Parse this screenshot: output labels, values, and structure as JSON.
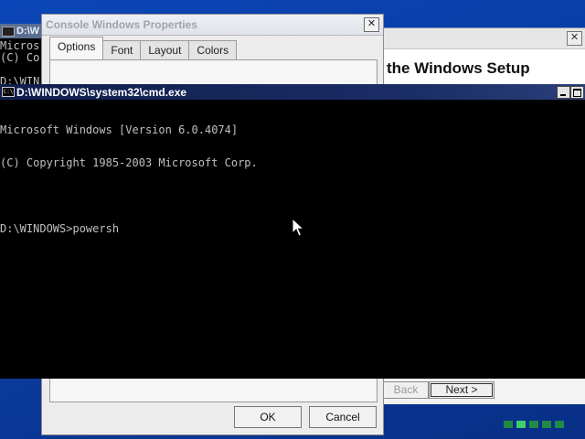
{
  "background_cmd": {
    "title": "D:\\W",
    "lines": [
      "Micros",
      "(C) Co",
      "",
      "D:\\WIN"
    ]
  },
  "setup": {
    "heading": "the Windows Setup",
    "back_label": "Back",
    "next_label": "Next >",
    "close_label": "✕"
  },
  "properties": {
    "title": "Console Windows Properties",
    "close_label": "✕",
    "tabs": [
      {
        "label": "Options",
        "active": true
      },
      {
        "label": "Font",
        "active": false
      },
      {
        "label": "Layout",
        "active": false
      },
      {
        "label": "Colors",
        "active": false
      }
    ],
    "ok_label": "OK",
    "cancel_label": "Cancel"
  },
  "cmd": {
    "title": "D:\\WINDOWS\\system32\\cmd.exe",
    "icon": "C:\\",
    "line1": "Microsoft Windows [Version 6.0.4074]",
    "line2": "(C) Copyright 1985-2003 Microsoft Corp.",
    "prompt": "D:\\WINDOWS>powersh"
  },
  "colors": {
    "desktop": "#0a3ea8",
    "console_bg": "#000000",
    "console_text": "#c0c0c0",
    "titlebar": "#1a2d66"
  },
  "icons": [
    "console-icon",
    "close-icon",
    "minimize-icon",
    "maximize-icon",
    "mouse-pointer-icon"
  ]
}
